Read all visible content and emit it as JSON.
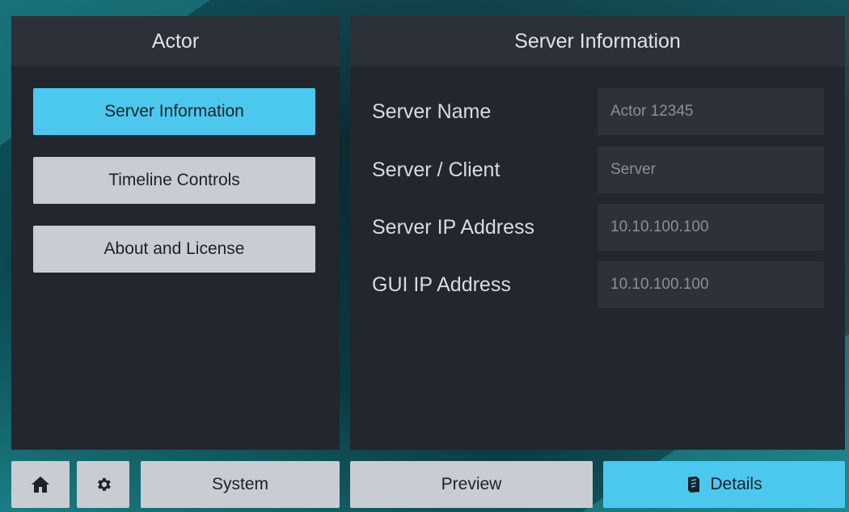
{
  "left_panel": {
    "title": "Actor",
    "menu": [
      {
        "label": "Server Information",
        "active": true
      },
      {
        "label": "Timeline Controls",
        "active": false
      },
      {
        "label": "About and License",
        "active": false
      }
    ]
  },
  "right_panel": {
    "title": "Server Information",
    "rows": [
      {
        "label": "Server Name",
        "value": "Actor 12345"
      },
      {
        "label": "Server / Client",
        "value": "Server"
      },
      {
        "label": "Server IP Address",
        "value": "10.10.100.100"
      },
      {
        "label": "GUI IP Address",
        "value": "10.10.100.100"
      }
    ]
  },
  "bottom_bar": {
    "home_icon": "home-icon",
    "settings_icon": "gear-icon",
    "system_label": "System",
    "preview_label": "Preview",
    "details_label": "Details",
    "details_icon": "details-icon"
  },
  "colors": {
    "accent": "#4cc8ef",
    "button": "#c9ccd3",
    "panel": "#22262e"
  }
}
